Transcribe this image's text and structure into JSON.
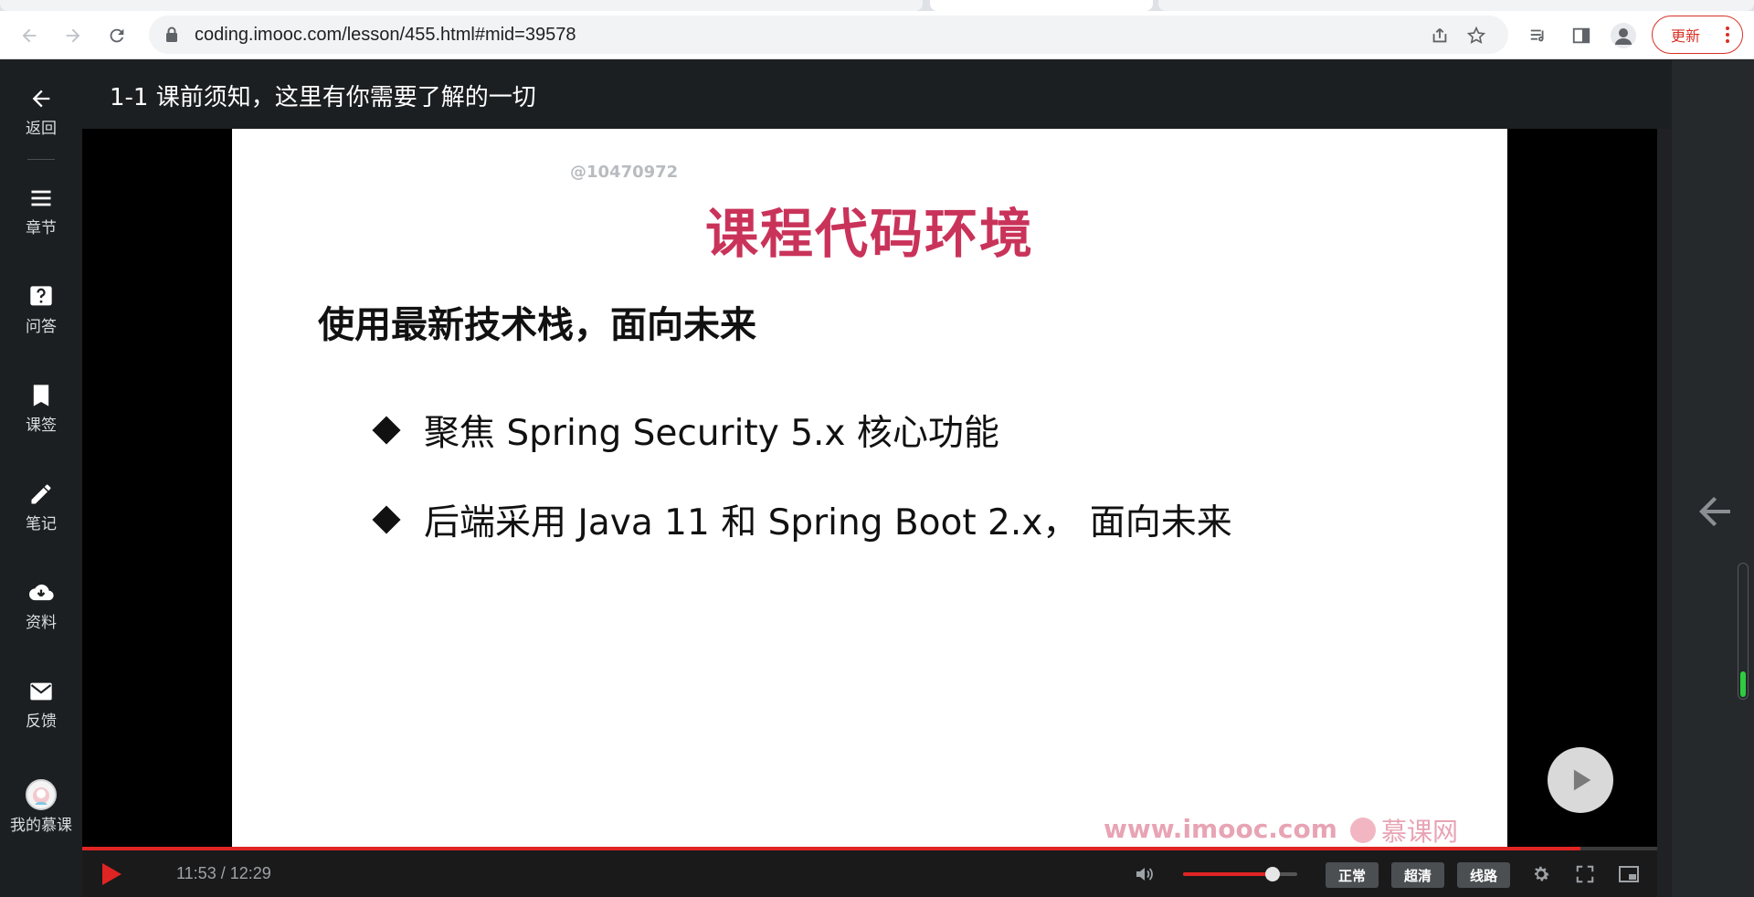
{
  "browser": {
    "url": "coding.imooc.com/lesson/455.html#mid=39578",
    "update_label": "更新"
  },
  "rail": {
    "items": [
      {
        "label": "返回",
        "icon": "back-arrow-icon"
      },
      {
        "label": "章节",
        "icon": "menu-icon"
      },
      {
        "label": "问答",
        "icon": "question-icon"
      },
      {
        "label": "课签",
        "icon": "bookmark-icon"
      },
      {
        "label": "笔记",
        "icon": "pencil-icon"
      },
      {
        "label": "资料",
        "icon": "cloud-download-icon"
      },
      {
        "label": "反馈",
        "icon": "mail-icon"
      },
      {
        "label": "我的慕课",
        "icon": "avatar-icon"
      }
    ]
  },
  "lesson": {
    "title": "1-1 课前须知，这里有你需要了解的一切"
  },
  "slide": {
    "watermark_id": "@10470972",
    "title": "课程代码环境",
    "subtitle": "使用最新技术栈，面向未来",
    "bullets": [
      "聚焦 Spring Security 5.x 核心功能",
      "后端采用 Java 11 和 Spring Boot 2.x， 面向未来"
    ],
    "site_watermark": "www.imooc.com",
    "brand_watermark": "慕课网"
  },
  "player": {
    "time": "11:53 / 12:29",
    "progress": 0.951,
    "volume": 0.78,
    "speed_label": "正常",
    "quality_label": "超清",
    "route_label": "线路"
  },
  "colors": {
    "accent": "#e02424",
    "slide_title": "#c9335a",
    "update": "#d93025",
    "scroll_indicator": "#2ecc40"
  }
}
